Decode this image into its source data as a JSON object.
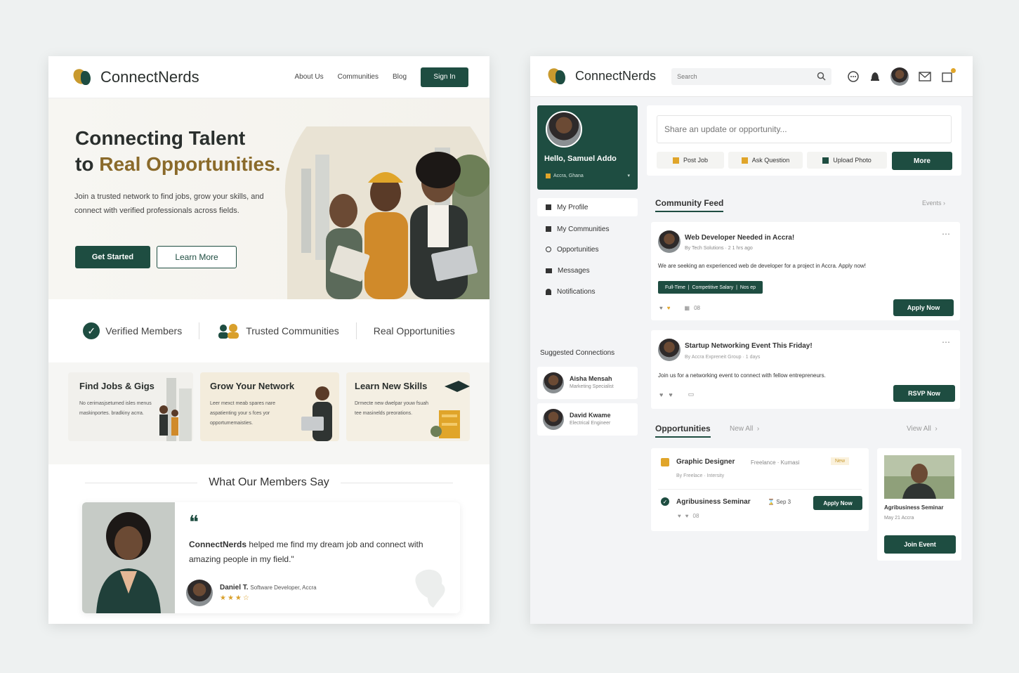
{
  "brand": "ConnectNerds",
  "landing": {
    "nav": {
      "about": "About Us",
      "communities": "Communities",
      "blog": "Blog",
      "signin": "Sign In"
    },
    "hero": {
      "title_line1": "Connecting Talent",
      "title_line2_prefix": "to ",
      "title_line2_accent": "Real Opportunities.",
      "subtitle": "Join a trusted network to find jobs, grow your skills, and connect with verified professionals across fields.",
      "get_started": "Get Started",
      "learn_more": "Learn More"
    },
    "features": [
      "Verified Members",
      "Trusted Communities",
      "Real Opportunities"
    ],
    "cards": [
      {
        "title": "Find Jobs & Gigs",
        "text": "No cerimasjsetumed isles menus maskinportes. bradkiny acrra."
      },
      {
        "title": "Grow Your Network",
        "text": "Leer mexct meab spares nare aspatienting your s fces yor opportumemaisties."
      },
      {
        "title": "Learn New Skills",
        "text": "Drmecte new dwelpar youw fsuah tee masinelds preorations."
      }
    ],
    "testimonials": {
      "heading": "What Our Members Say",
      "quote_mark": "❝",
      "quote_brand": "ConnectNerds",
      "quote_rest": " helped me find my dream job and connect with amazing people in my field.\"",
      "author": "Daniel T.",
      "author_role": "Software Developer, Accra",
      "stars": "★★★☆"
    }
  },
  "app": {
    "search_placeholder": "Search",
    "profile": {
      "greeting": "Hello, Samuel Addo",
      "location": "Accra, Ghana"
    },
    "menu": [
      "My Profile",
      "My Communities",
      "Opportunities",
      "Messages",
      "Notifications"
    ],
    "suggested": {
      "heading": "Suggested Connections",
      "people": [
        {
          "name": "Aisha Mensah",
          "role": "Marketing Specialist"
        },
        {
          "name": "David Kwame",
          "role": "Electrical Engineer"
        }
      ]
    },
    "composer": {
      "placeholder": "Share an update or opportunity...",
      "post_job": "Post Job",
      "ask_question": "Ask Question",
      "upload_photo": "Upload Photo",
      "more": "More"
    },
    "feed": {
      "heading": "Community Feed",
      "events_link": "Events ›",
      "posts": [
        {
          "title": "Web Developer Needed in Accra!",
          "meta": "By Tech Solutions · 2 1 hrs ago",
          "body": "We are seeking an experienced web de developer for a project in Accra. Apply now!",
          "tags": "Full-Time  |  Competitive Salary  |  Nos ep",
          "count": "08",
          "action": "Apply Now"
        },
        {
          "title": "Startup Networking Event This Friday!",
          "meta": "By Accra Expreneit Group · 1 days",
          "body": "Join us for a networking event to connect with fellow entrepreneurs.",
          "action": "RSVP Now"
        }
      ]
    },
    "opportunities": {
      "heading": "Opportunities",
      "new_all": "New All  ›",
      "view_all": "View All  ›",
      "items": [
        {
          "title": "Graphic Designer",
          "meta": "Freelance · Kumasi",
          "badge": "New",
          "sub": "By Freelace · Intersity"
        },
        {
          "title": "Agribusiness Seminar",
          "meta": "Sep 3",
          "action": "Apply Now",
          "count": "08"
        }
      ],
      "event": {
        "title": "Agribusiness Seminar",
        "date": "May 21 Accra",
        "action": "Join Event"
      }
    }
  }
}
